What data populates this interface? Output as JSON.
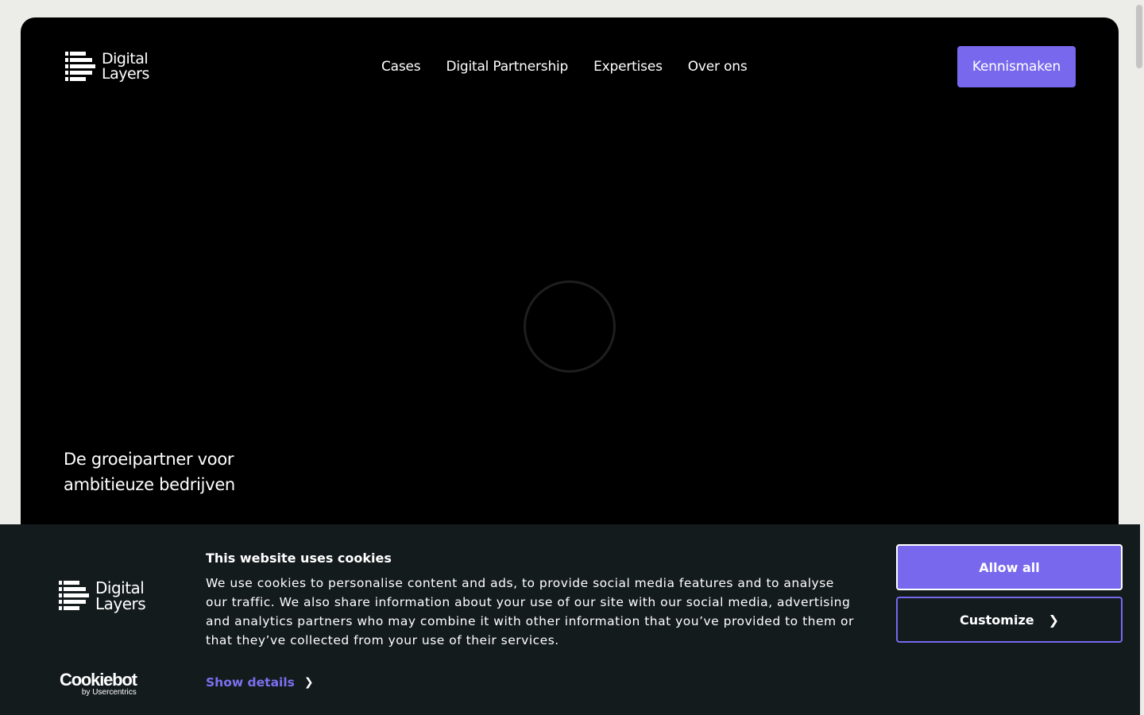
{
  "brand": {
    "name_line1": "Digital",
    "name_line2": "Layers"
  },
  "nav": {
    "items": [
      {
        "label": "Cases"
      },
      {
        "label": "Digital Partnership"
      },
      {
        "label": "Expertises"
      },
      {
        "label": "Over ons"
      }
    ],
    "cta_label": "Kennismaken"
  },
  "hero": {
    "tagline": "De groeipartner voor ambitieuze bedrijven"
  },
  "cookie_banner": {
    "title": "This website uses cookies",
    "text": "We use cookies to personalise content and ads, to provide social media features and to analyse our traffic. We also share information about your use of our site with our social media, advertising and analytics partners who may combine it with other information that you’ve provided to them or that they’ve collected from your use of their services.",
    "show_details_label": "Show details",
    "allow_all_label": "Allow all",
    "customize_label": "Customize",
    "provider_name": "Cookiebot",
    "provider_sub": "by Usercentrics"
  },
  "colors": {
    "accent": "#7768ee",
    "hero_bg": "#000000",
    "banner_bg": "#141b1d",
    "page_bg": "#ecece8"
  },
  "icons": {
    "logo_mark": "stacked-layers-logo-icon",
    "chevron": "chevron-right-icon",
    "loading": "loading-spinner-icon"
  }
}
